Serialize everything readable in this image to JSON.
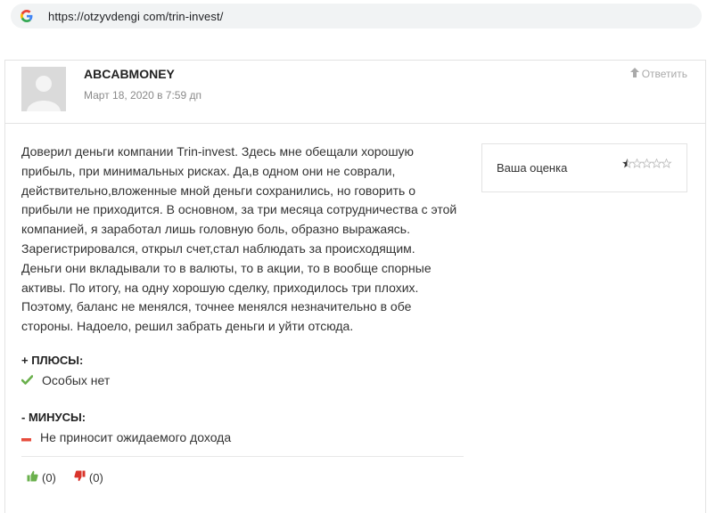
{
  "browser": {
    "url": "https://otzyvdengi com/trin-invest/"
  },
  "comment": {
    "author": "ABCABMONEY",
    "date": "Март 18, 2020 в 7:59 дп",
    "reply_label": "Ответить",
    "text": "Доверил деньги компании Trin-invest. Здесь мне обещали хорошую прибыль, при минимальных рисках. Да,в одном они не соврали, действительно,вложенные мной деньги сохранились, но говорить о прибыли не приходится. В основном, за три месяца сотрудничества с этой компанией, я заработал лишь головную боль, образно выражаясь. Зарегистрировался, открыл счет,стал наблюдать за происходящим. Деньги они вкладывали то в валюты, то в акции, то в вообще спорные активы. По итогу, на одну хорошую сделку, приходилось три плохих. Поэтому, баланс не менялся, точнее менялся незначительно в обе стороны. Надоело, решил забрать деньги и уйти отсюда.",
    "rating_label": "Ваша оценка",
    "rating_value": 0.5,
    "rating_max": 5,
    "pros_title": "+ ПЛЮСЫ:",
    "pros": [
      "Особых нет"
    ],
    "cons_title": "- МИНУСЫ:",
    "cons": [
      "Не приносит ожидаемого дохода"
    ],
    "likes": "(0)",
    "dislikes": "(0)"
  },
  "colors": {
    "check": "#6ab04c",
    "minus": "#e74c3c",
    "thumb_up": "#6ab04c",
    "thumb_down": "#d9342b",
    "star_filled": "#333333",
    "star_empty": "#bbbbbb"
  },
  "icons": {
    "browser": "google-g-icon",
    "reply": "arrow-up-icon",
    "avatar": "default-avatar-icon",
    "pro": "check-icon",
    "con": "minus-icon",
    "like": "thumbs-up-icon",
    "dislike": "thumbs-down-icon",
    "rating": "star-icon"
  }
}
